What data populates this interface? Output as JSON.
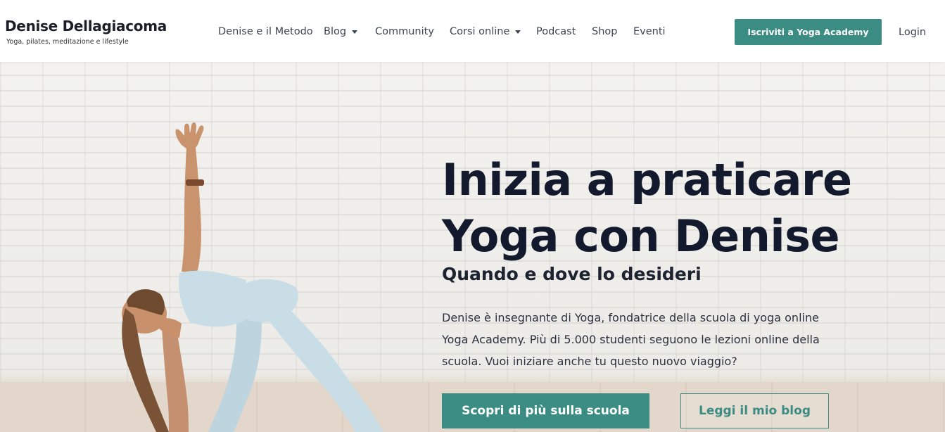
{
  "brand": {
    "name": "Denise Dellagiacoma",
    "tagline": "Yoga, pilates, meditazione e lifestyle"
  },
  "nav": {
    "items": [
      {
        "label": "Denise e il Metodo",
        "dropdown": false
      },
      {
        "label": "Blog",
        "dropdown": true
      },
      {
        "label": "Community",
        "dropdown": false
      },
      {
        "label": "Corsi online",
        "dropdown": true
      },
      {
        "label": "Podcast",
        "dropdown": false
      },
      {
        "label": "Shop",
        "dropdown": false
      },
      {
        "label": "Eventi",
        "dropdown": false
      }
    ],
    "cta_label": "Iscriviti a Yoga Academy",
    "login_label": "Login"
  },
  "hero": {
    "title_line1": "Inizia a praticare",
    "title_line2": "Yoga con Denise",
    "subtitle": "Quando e dove lo desideri",
    "description_line1": "Denise è insegnante di Yoga, fondatrice della scuola di yoga online",
    "description_line2": "Yoga Academy. Più di 5.000 studenti seguono le lezioni online della",
    "description_line3": "scuola. Vuoi iniziare anche tu questo nuovo viaggio?",
    "primary_button": "Scopri di più sulla scuola",
    "secondary_button": "Leggi il mio blog"
  },
  "colors": {
    "accent": "#3b8c82",
    "heading": "#141a2e",
    "nav_text": "#3d4452",
    "wall": "#efeeeb",
    "outfit": "#c9dde6"
  }
}
